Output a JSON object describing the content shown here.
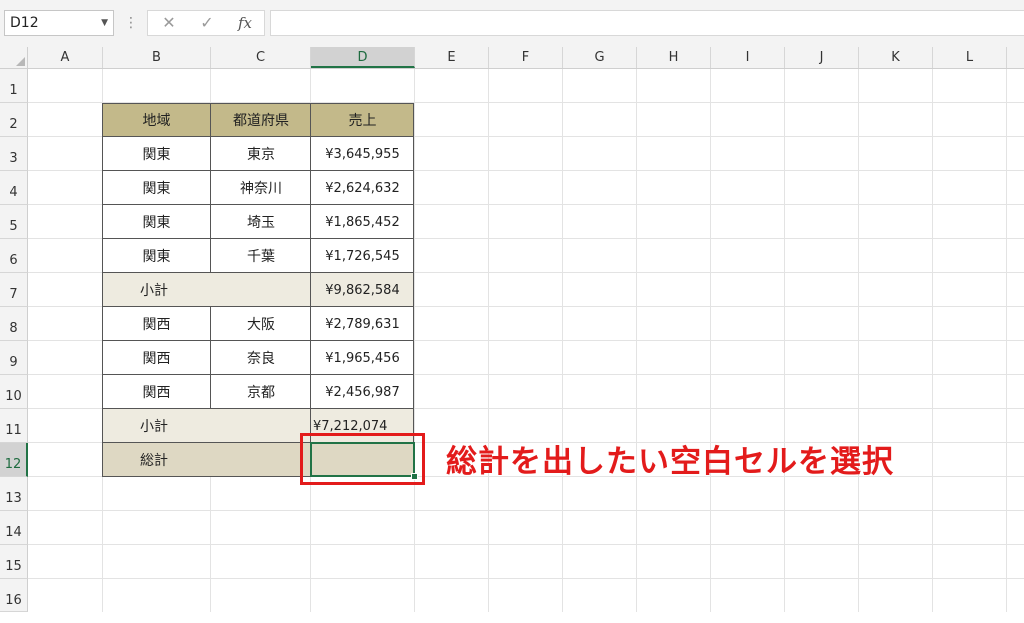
{
  "formula_bar": {
    "name_box": "D12",
    "dots": "⋮",
    "cancel_icon": "✕",
    "enter_icon": "✓",
    "fx_label": "fx",
    "formula": ""
  },
  "columns": [
    "A",
    "B",
    "C",
    "D",
    "E",
    "F",
    "G",
    "H",
    "I",
    "J",
    "K",
    "L"
  ],
  "rows": [
    "1",
    "2",
    "3",
    "4",
    "5",
    "6",
    "7",
    "8",
    "9",
    "10",
    "11",
    "12",
    "13",
    "14",
    "15",
    "16"
  ],
  "selected_cell": "D12",
  "table": {
    "headers": [
      "地域",
      "都道府県",
      "売上"
    ],
    "rows": [
      {
        "region": "関東",
        "pref": "東京",
        "sales": "¥3,645,955"
      },
      {
        "region": "関東",
        "pref": "神奈川",
        "sales": "¥2,624,632"
      },
      {
        "region": "関東",
        "pref": "埼玉",
        "sales": "¥1,865,452"
      },
      {
        "region": "関東",
        "pref": "千葉",
        "sales": "¥1,726,545"
      },
      {
        "subtotal_label": "小計",
        "sales": "¥9,862,584"
      },
      {
        "region": "関西",
        "pref": "大阪",
        "sales": "¥2,789,631"
      },
      {
        "region": "関西",
        "pref": "奈良",
        "sales": "¥1,965,456"
      },
      {
        "region": "関西",
        "pref": "京都",
        "sales": "¥2,456,987"
      },
      {
        "subtotal_label": "小計",
        "sales": "¥7,212,074"
      },
      {
        "total_label": "総計",
        "sales": ""
      }
    ]
  },
  "annotation": {
    "text": "総計を出したい空白セルを選択",
    "color": "#e31b1b"
  },
  "colors": {
    "header_fill": "#c3b98a",
    "subtotal_fill": "#eeebe0",
    "total_fill": "#ded8c3",
    "selection": "#217346"
  }
}
